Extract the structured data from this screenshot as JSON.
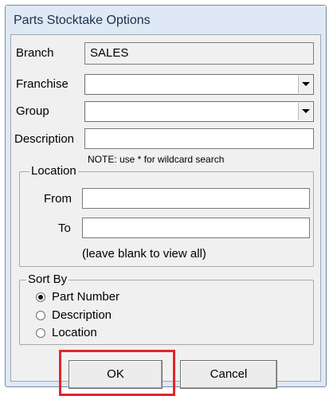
{
  "window": {
    "title": "Parts Stocktake Options"
  },
  "form": {
    "branch": {
      "label": "Branch",
      "value": "SALES"
    },
    "franchise": {
      "label": "Franchise",
      "value": ""
    },
    "group": {
      "label": "Group",
      "value": ""
    },
    "description": {
      "label": "Description",
      "value": ""
    },
    "note": "NOTE: use * for wildcard search"
  },
  "location": {
    "title": "Location",
    "from_label": "From",
    "to_label": "To",
    "from_value": "",
    "to_value": "",
    "hint": "(leave blank to view all)"
  },
  "sort_by": {
    "title": "Sort By",
    "options": [
      {
        "label": "Part Number",
        "checked": true
      },
      {
        "label": "Description",
        "checked": false
      },
      {
        "label": "Location",
        "checked": false
      }
    ]
  },
  "buttons": {
    "ok": "OK",
    "cancel": "Cancel"
  },
  "colors": {
    "highlight": "#e2262c",
    "title_text": "#1d2f4c"
  }
}
